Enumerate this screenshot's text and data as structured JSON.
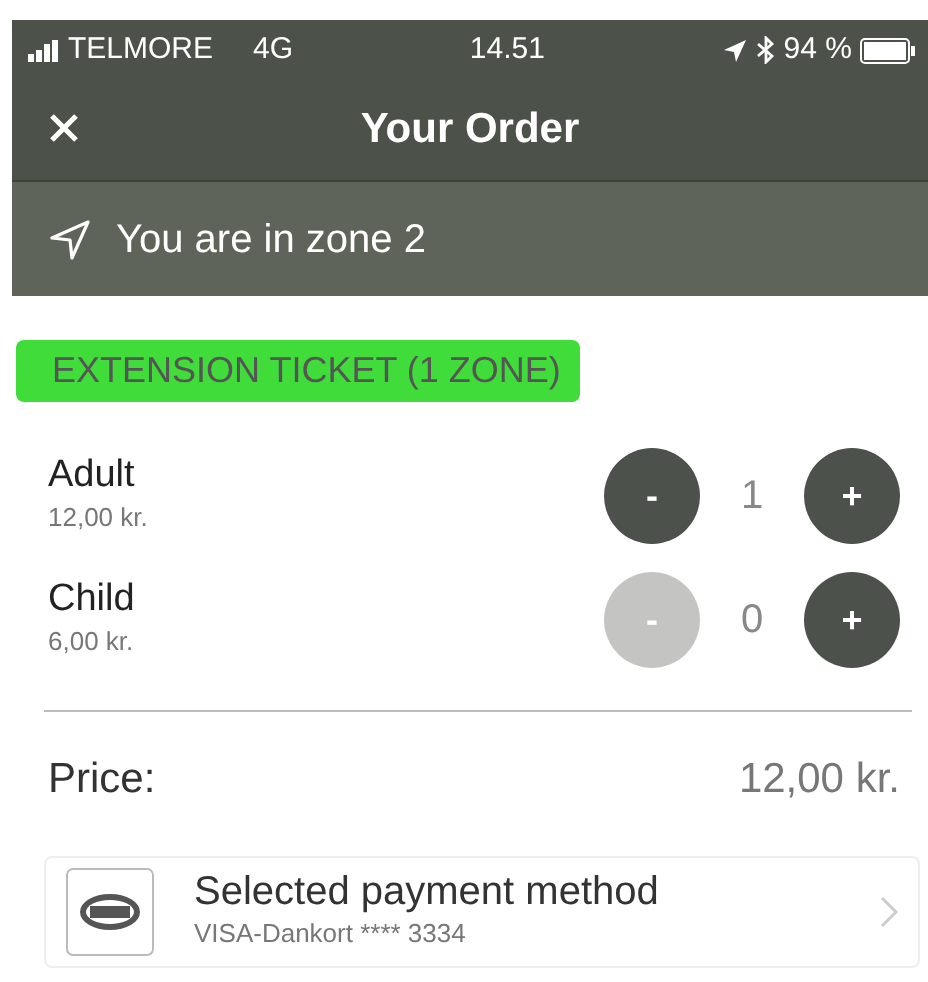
{
  "status_bar": {
    "carrier": "TELMORE",
    "network": "4G",
    "time": "14.51",
    "battery": "94 %"
  },
  "header": {
    "title": "Your Order"
  },
  "zone_bar": {
    "text": "You are in zone 2"
  },
  "section": {
    "title": "EXTENSION TICKET (1 ZONE)",
    "highlighted": true
  },
  "tickets": [
    {
      "name": "Adult",
      "price": "12,00 kr.",
      "quantity": "1",
      "minus_disabled": false,
      "minus": "-",
      "plus": "+"
    },
    {
      "name": "Child",
      "price": "6,00 kr.",
      "quantity": "0",
      "minus_disabled": true,
      "minus": "-",
      "plus": "+"
    }
  ],
  "total": {
    "label": "Price:",
    "value": "12,00 kr."
  },
  "payment": {
    "title": "Selected payment method",
    "card": "VISA-Dankort **** 3334"
  }
}
